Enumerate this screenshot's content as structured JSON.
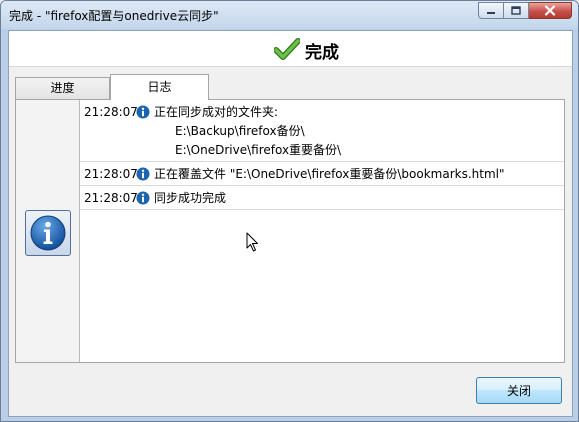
{
  "window": {
    "title": "完成 - \"firefox配置与onedrive云同步\""
  },
  "header": {
    "title": "完成"
  },
  "tabs": [
    {
      "label": "进度",
      "active": false
    },
    {
      "label": "日志",
      "active": true
    }
  ],
  "log": {
    "entries": [
      {
        "time": "21:28:07",
        "message": "正在同步成对的文件夹:",
        "details": [
          "E:\\Backup\\firefox备份\\",
          "E:\\OneDrive\\firefox重要备份\\"
        ]
      },
      {
        "time": "21:28:07",
        "message": "正在覆盖文件 \"E:\\OneDrive\\firefox重要备份\\bookmarks.html\""
      },
      {
        "time": "21:28:07",
        "message": "同步成功完成"
      }
    ]
  },
  "footer": {
    "close_label": "关闭"
  },
  "icons": {
    "status": "info-icon",
    "header": "check-icon"
  },
  "colors": {
    "check": "#4a9e2c",
    "info": "#1b64b0"
  }
}
